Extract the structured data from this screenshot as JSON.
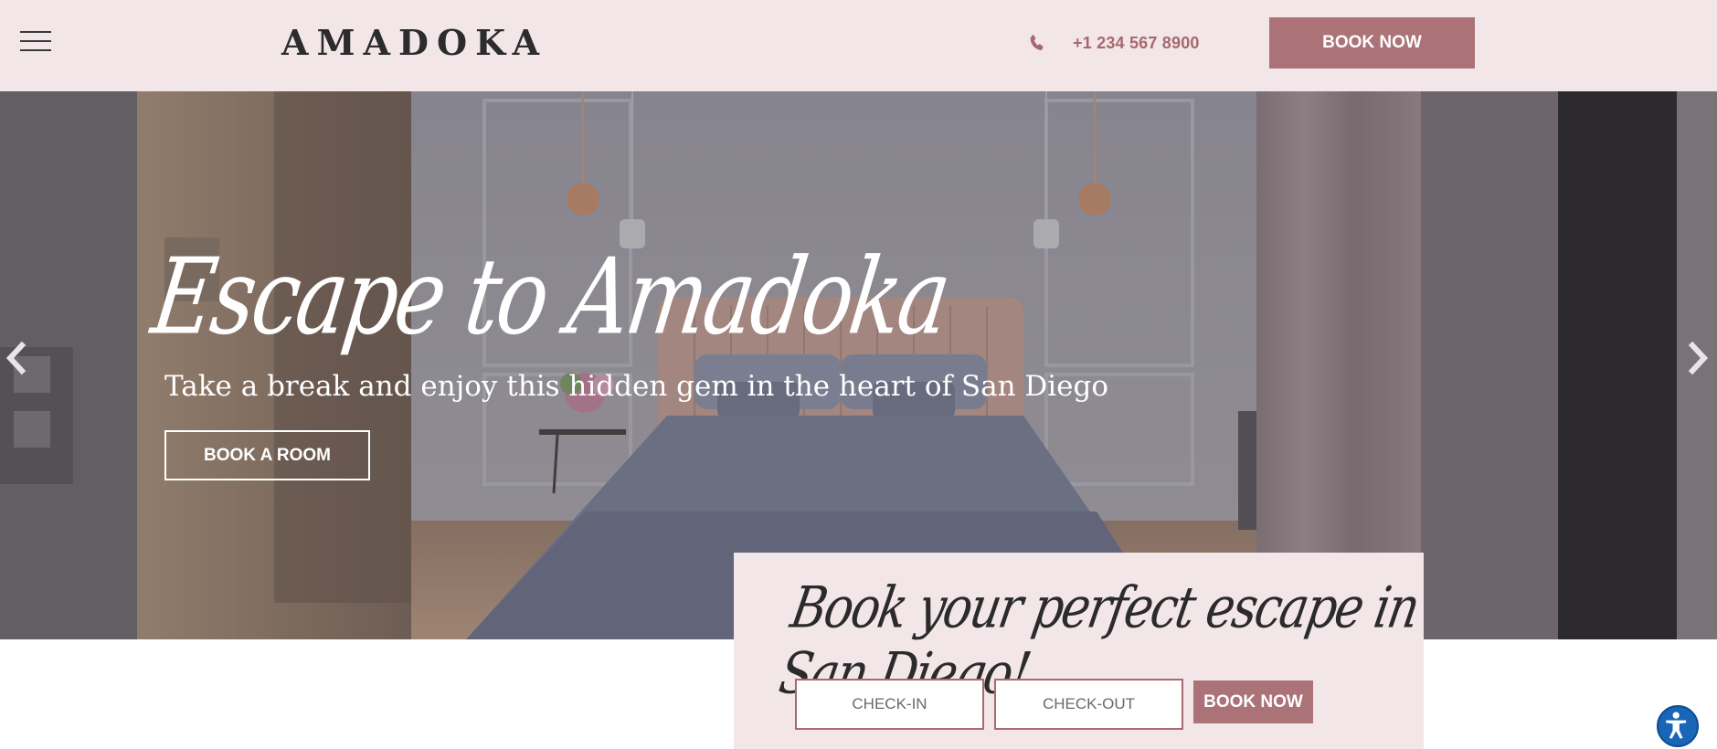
{
  "header": {
    "brand": "AMADOKA",
    "phone": "+1 234 567 8900",
    "book_now_label": "BOOK NOW"
  },
  "hero": {
    "title": "Escape to Amadoka",
    "subtitle": "Take a break and enjoy this hidden gem in the heart of San Diego",
    "cta_label": "BOOK A ROOM"
  },
  "booking": {
    "title": "Book your perfect escape in San Diego!",
    "checkin_placeholder": "CHECK-IN",
    "checkout_placeholder": "CHECK-OUT",
    "book_now_label": "BOOK NOW"
  },
  "colors": {
    "header_bg": "#f2e6e8",
    "accent": "#ab7377",
    "phone_text": "#a6686f",
    "accessibility_button": "#1966b8"
  },
  "icons": [
    "menu-icon",
    "phone-icon",
    "chevron-left-icon",
    "chevron-right-icon",
    "accessibility-icon"
  ]
}
